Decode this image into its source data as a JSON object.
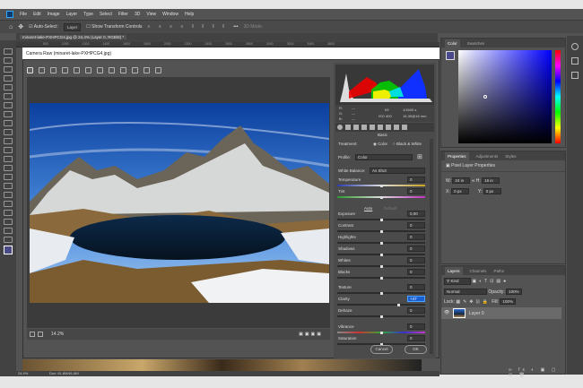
{
  "menu": [
    "File",
    "Edit",
    "Image",
    "Layer",
    "Type",
    "Select",
    "Filter",
    "3D",
    "View",
    "Window",
    "Help"
  ],
  "options": {
    "auto_select": "Auto-Select:",
    "layer_select": "Layer",
    "show_transform": "Show Transform Controls",
    "more": "•••",
    "mode_3d": "3D Mode:"
  },
  "document_tab": "minaret-lake-PXHPCG4.jpg @ 24,4% (Layer 0, RGB/8) *",
  "ruler_ticks": [
    "800",
    "1000",
    "1200",
    "1400",
    "1600",
    "1800",
    "2000",
    "2200",
    "2400",
    "2600",
    "2800",
    "3000",
    "3200",
    "3400",
    "3600"
  ],
  "camera_raw": {
    "title": "Camera Raw (minaret-lake-PXHPCG4.jpg)",
    "zoom": "14.2%",
    "info": {
      "r": "R:",
      "g": "G:",
      "b": "B:",
      "dash": "---",
      "aperture": "f/9",
      "shutter": "1/1600 s",
      "iso": "ISO 400",
      "lens": "16-35@16 mm"
    },
    "panel_title": "Basic",
    "treatment_label": "Treatment:",
    "treatment_color": "Color",
    "treatment_bw": "Black & White",
    "profile_label": "Profile:",
    "profile_value": "Color",
    "wb_label": "White Balance:",
    "wb_value": "As Shot",
    "auto": "Auto",
    "default": "Default",
    "sliders": [
      {
        "label": "Temperature",
        "value": "0",
        "pos": 0.5
      },
      {
        "label": "Tint",
        "value": "0",
        "pos": 0.5
      },
      {
        "label": "Exposure",
        "value": "0,00",
        "pos": 0.5
      },
      {
        "label": "Contrast",
        "value": "0",
        "pos": 0.5
      },
      {
        "label": "Highlights",
        "value": "0",
        "pos": 0.5
      },
      {
        "label": "Shadows",
        "value": "0",
        "pos": 0.5
      },
      {
        "label": "Whites",
        "value": "0",
        "pos": 0.5
      },
      {
        "label": "Blacks",
        "value": "0",
        "pos": 0.5
      },
      {
        "label": "Texture",
        "value": "0",
        "pos": 0.5
      },
      {
        "label": "Clarity",
        "value": "+47",
        "pos": 0.7
      },
      {
        "label": "Dehaze",
        "value": "0",
        "pos": 0.5
      },
      {
        "label": "Vibrance",
        "value": "0",
        "pos": 0.5
      },
      {
        "label": "Saturation",
        "value": "0",
        "pos": 0.5
      }
    ],
    "cancel": "Cancel",
    "ok": "OK"
  },
  "status": {
    "zoom": "24.4%",
    "doc": "Doc: 61,8M/61,8M"
  },
  "color_panel": {
    "tabs": [
      "Color",
      "Swatches"
    ],
    "fg": "#4a4a8a"
  },
  "properties": {
    "tabs": [
      "Properties",
      "Adjustments",
      "Styles"
    ],
    "heading": "Pixel Layer Properties",
    "w_label": "W:",
    "w_value": "24 in",
    "h_label": "H:",
    "h_value": "16 in",
    "x_label": "X:",
    "x_value": "0 px",
    "y_label": "Y:",
    "y_value": "0 px"
  },
  "layers": {
    "tabs": [
      "Layers",
      "Channels",
      "Paths"
    ],
    "kind": "Kind",
    "blend": "Normal",
    "opacity_label": "Opacity:",
    "opacity": "100%",
    "lock_label": "Lock:",
    "fill_label": "Fill:",
    "fill": "100%",
    "layer_name": "Layer 0"
  }
}
